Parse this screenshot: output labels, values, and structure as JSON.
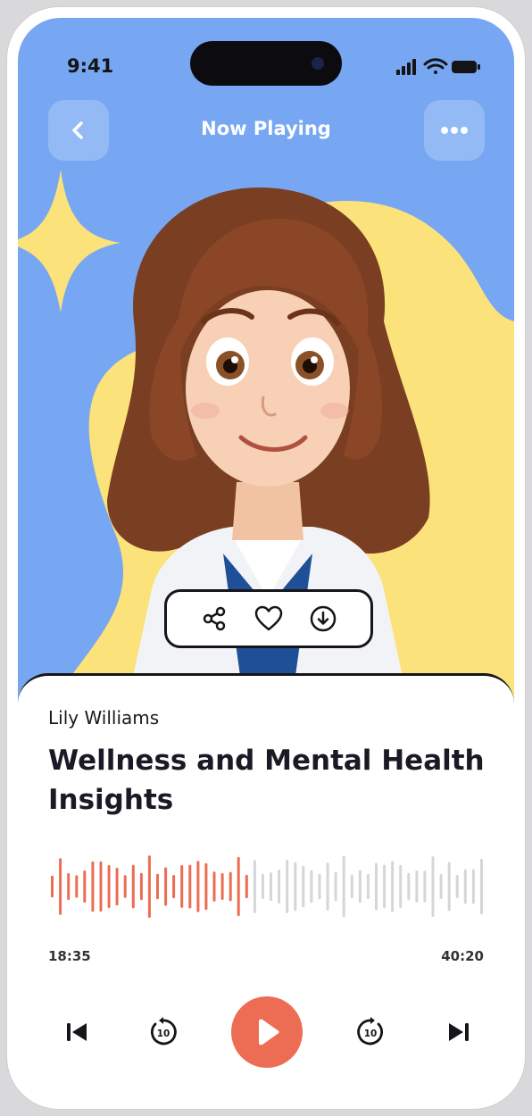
{
  "status_bar": {
    "time": "9:41"
  },
  "header": {
    "title": "Now Playing"
  },
  "track": {
    "artist": "Lily Williams",
    "title": "Wellness and Mental Health Insights"
  },
  "playback": {
    "elapsed": "18:35",
    "total": "40:20",
    "progress": 0.46,
    "skip_seconds": "10"
  },
  "colors": {
    "hero_bg": "#77a7f2",
    "accent": "#ec6d53",
    "wave_played": "#ec6d53",
    "wave_remaining": "#d6d6d9",
    "blob": "#fbe27a"
  },
  "icons": {
    "back": "chevron-left-icon",
    "more": "ellipsis-icon",
    "share": "share-icon",
    "like": "heart-icon",
    "download": "download-icon",
    "previous": "skip-previous-icon",
    "rewind": "rewind-10-icon",
    "play": "play-icon",
    "forward": "forward-10-icon",
    "next": "skip-next-icon"
  }
}
